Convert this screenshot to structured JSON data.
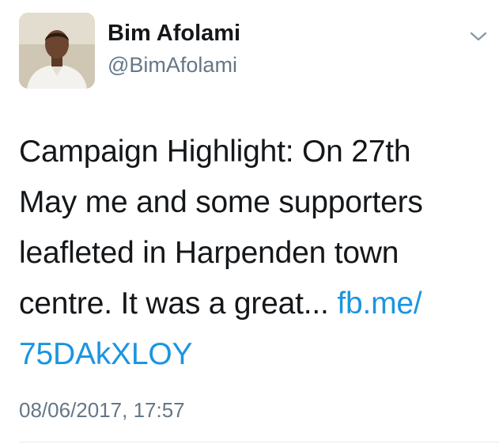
{
  "author": {
    "name": "Bim Afolami",
    "handle": "@BimAfolami",
    "avatar_icon": "profile-photo"
  },
  "tweet": {
    "lines": [
      "Campaign Highlight: On 27th",
      "May me and some supporters",
      "leafleted in Harpenden town",
      "centre. It was a great... "
    ],
    "link_part1": "fb.me/",
    "link_part2": "75DAkXLOY",
    "timestamp": "08/06/2017, 17:57"
  },
  "colors": {
    "link": "#1b95e0",
    "secondary_text": "#657786",
    "primary_text": "#14171a"
  },
  "icons": {
    "menu": "chevron-down-icon"
  }
}
